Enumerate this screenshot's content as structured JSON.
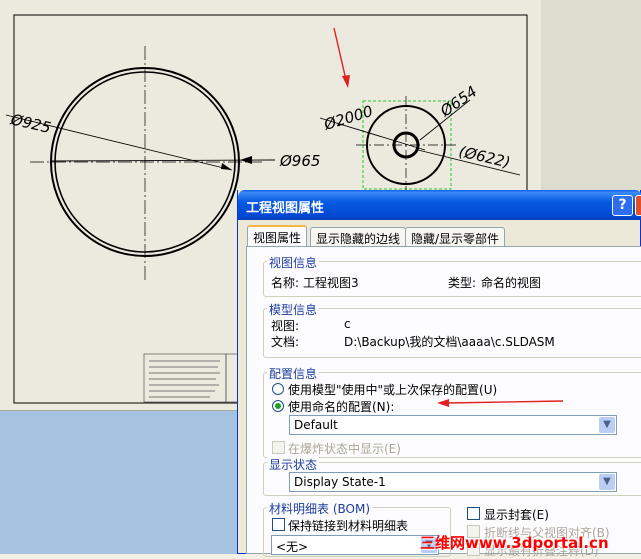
{
  "drawing": {
    "labels": {
      "d925": "Ø925",
      "d965": "Ø965",
      "d2000": "Ø2000",
      "d654": "Ø654",
      "d622": "(Ø622)"
    }
  },
  "dialog": {
    "title": "工程视图属性",
    "help_label": "?",
    "close_label": "×",
    "tabs": [
      "视图属性",
      "显示隐藏的边线",
      "隐藏/显示零部件"
    ],
    "view_info": {
      "title": "视图信息",
      "name_label": "名称:",
      "name_value": "工程视图3",
      "type_label": "类型:",
      "type_value": "命名的视图"
    },
    "model_info": {
      "title": "模型信息",
      "view_label": "视图:",
      "view_value": "c",
      "doc_label": "文档:",
      "doc_value": "D:\\Backup\\我的文档\\aaaa\\c.SLDASM"
    },
    "config_info": {
      "title": "配置信息",
      "option1": "使用模型\"使用中\"或上次保存的配置(U)",
      "option2": "使用命名的配置(N):",
      "config_value": "Default",
      "exploded": "在爆炸状态中显示(E)"
    },
    "display_state": {
      "title": "显示状态",
      "value": "Display State-1"
    },
    "bom": {
      "title": "材料明细表 (BOM)",
      "keep_link": "保持链接到材料明细表",
      "value": "<无>"
    },
    "options": {
      "show_envelope": "显示封套(E)",
      "broken_view": "折断线与父视图对齐(B)",
      "show_all_exploded": "显示最有折叠注释(D)"
    }
  },
  "watermark": "三维网www.3dportal.cn",
  "colors": {
    "title_bar": "#0559e1",
    "annotation_arrow": "#e02020",
    "group_title": "#1e3c9c"
  }
}
